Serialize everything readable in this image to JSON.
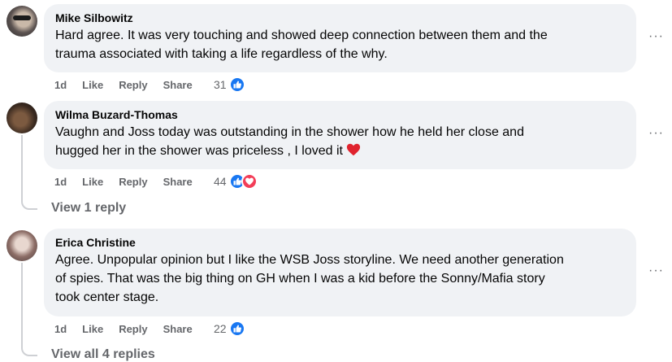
{
  "comments": [
    {
      "author": "Mike Silbowitz",
      "lines": [
        "Hard agree. It was very touching and showed deep connection between them and the",
        "trauma associated with taking a life regardless of the why."
      ],
      "time": "1d",
      "like_label": "Like",
      "reply_label": "Reply",
      "share_label": "Share",
      "reaction_count": "31",
      "reactions": [
        "like"
      ]
    },
    {
      "author": "Wilma Buzard-Thomas",
      "lines": [
        "Vaughn and Joss today was outstanding in the shower how he held her close and",
        "hugged her in the shower was priceless , I loved it"
      ],
      "time": "1d",
      "like_label": "Like",
      "reply_label": "Reply",
      "share_label": "Share",
      "reaction_count": "44",
      "reactions": [
        "like",
        "love"
      ],
      "view_replies": "View 1 reply"
    },
    {
      "author": "Erica Christine",
      "lines": [
        "Agree. Unpopular opinion but I like the WSB Joss storyline. We need another generation",
        "of spies. That was the big thing on GH when I was a kid before the Sonny/Mafia story",
        "took center stage."
      ],
      "time": "1d",
      "like_label": "Like",
      "reply_label": "Reply",
      "share_label": "Share",
      "reaction_count": "22",
      "reactions": [
        "like"
      ],
      "view_replies": "View all 4 replies"
    }
  ],
  "more_label": "···",
  "colors": {
    "bubble": "#f0f2f5",
    "meta": "#65676b",
    "like": "#1877f2",
    "love": "#f33e58"
  },
  "icons": {
    "like": "thumbs-up-icon",
    "love": "heart-icon",
    "emoji": "red-heart-emoji"
  }
}
